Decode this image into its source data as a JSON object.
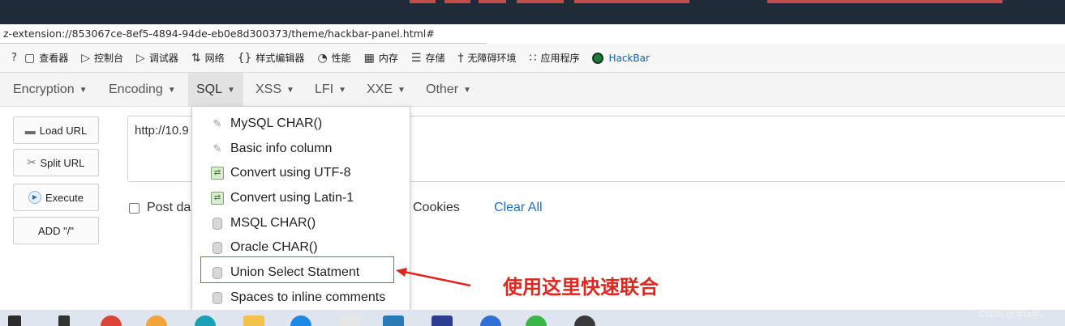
{
  "browser": {
    "url": "z-extension://853067ce-8ef5-4894-94de-eb0e8d300373/theme/hackbar-panel.html#"
  },
  "devtools": {
    "left_mark": "?",
    "tabs": [
      {
        "icon": "inspector-icon",
        "glyph": "▢",
        "label": "查看器"
      },
      {
        "icon": "console-icon",
        "glyph": "▷",
        "label": "控制台"
      },
      {
        "icon": "debugger-icon",
        "glyph": "▷",
        "label": "调试器"
      },
      {
        "icon": "network-icon",
        "glyph": "⇅",
        "label": "网络"
      },
      {
        "icon": "style-editor-icon",
        "glyph": "{}",
        "label": "样式编辑器"
      },
      {
        "icon": "performance-icon",
        "glyph": "◔",
        "label": "性能"
      },
      {
        "icon": "memory-icon",
        "glyph": "▦",
        "label": "内存"
      },
      {
        "icon": "storage-icon",
        "glyph": "☰",
        "label": "存储"
      },
      {
        "icon": "accessibility-icon",
        "glyph": "†",
        "label": "无障碍环境"
      },
      {
        "icon": "application-icon",
        "glyph": "∷",
        "label": "应用程序"
      },
      {
        "icon": "hackbar-icon",
        "glyph": "",
        "label": "HackBar"
      }
    ],
    "active_tab": "HackBar",
    "accent_color": "#0a63b8"
  },
  "hackbar": {
    "menus": [
      {
        "label": "Encryption"
      },
      {
        "label": "Encoding"
      },
      {
        "label": "SQL"
      },
      {
        "label": "XSS"
      },
      {
        "label": "LFI"
      },
      {
        "label": "XXE"
      },
      {
        "label": "Other"
      }
    ],
    "active_menu": "SQL",
    "buttons": {
      "load_url": "Load URL",
      "split_url": "Split URL",
      "execute": "Execute",
      "add_slash": "ADD \"/\""
    },
    "url_value": "http://10.9",
    "options": {
      "post_data": "Post da",
      "cookies": "Cookies",
      "clear_all": "Clear All"
    },
    "sql_dropdown": [
      {
        "label": "MySQL CHAR()",
        "icon": "pen-icon"
      },
      {
        "label": "Basic info column",
        "icon": "pen-icon"
      },
      {
        "label": "Convert using UTF-8",
        "icon": "convert-icon"
      },
      {
        "label": "Convert using Latin-1",
        "icon": "convert-icon"
      },
      {
        "label": "MSQL CHAR()",
        "icon": "database-icon"
      },
      {
        "label": "Oracle CHAR()",
        "icon": "database-icon"
      },
      {
        "label": "Union Select Statment",
        "icon": "database-icon"
      },
      {
        "label": "Spaces to inline comments",
        "icon": "database-icon"
      }
    ],
    "highlighted_item": "Union Select Statment"
  },
  "annotation": {
    "note": "使用这里快速联合",
    "color": "#e0271f"
  },
  "watermark": "CSDN @半ta半。"
}
